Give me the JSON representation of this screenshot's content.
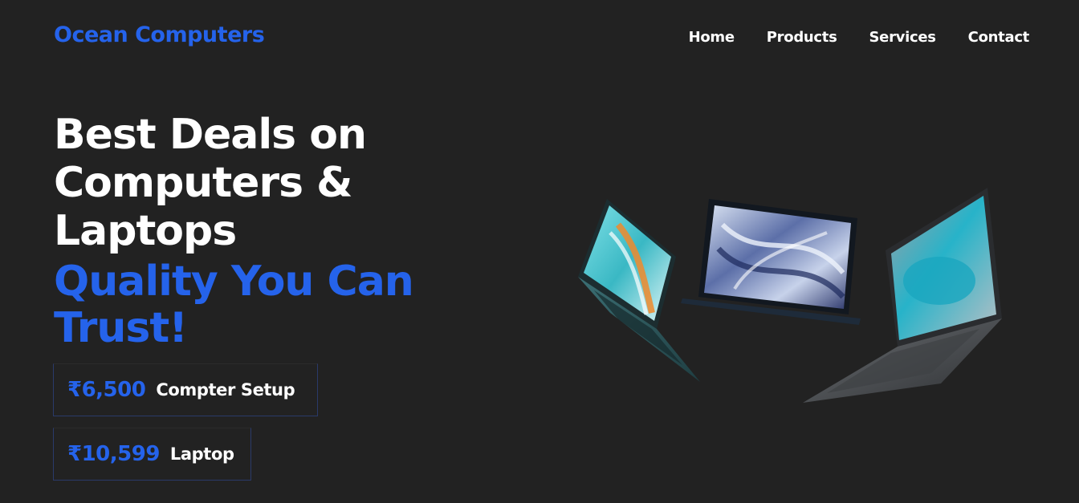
{
  "header": {
    "brand": "Ocean Computers",
    "nav": [
      "Home",
      "Products",
      "Services",
      "Contact"
    ]
  },
  "hero": {
    "title_lines": [
      "Best Deals on",
      "Computers &",
      "Laptops"
    ],
    "subtitle_lines": [
      "Quality You Can",
      "Trust!"
    ]
  },
  "deals": [
    {
      "price": "₹6,500",
      "label": "Compter Setup"
    },
    {
      "price": "₹10,599",
      "label": "Laptop"
    }
  ],
  "colors": {
    "background": "#222222",
    "accent": "#2563eb",
    "text": "#ffffff"
  },
  "hero_image": {
    "icon": "laptops-illustration"
  }
}
